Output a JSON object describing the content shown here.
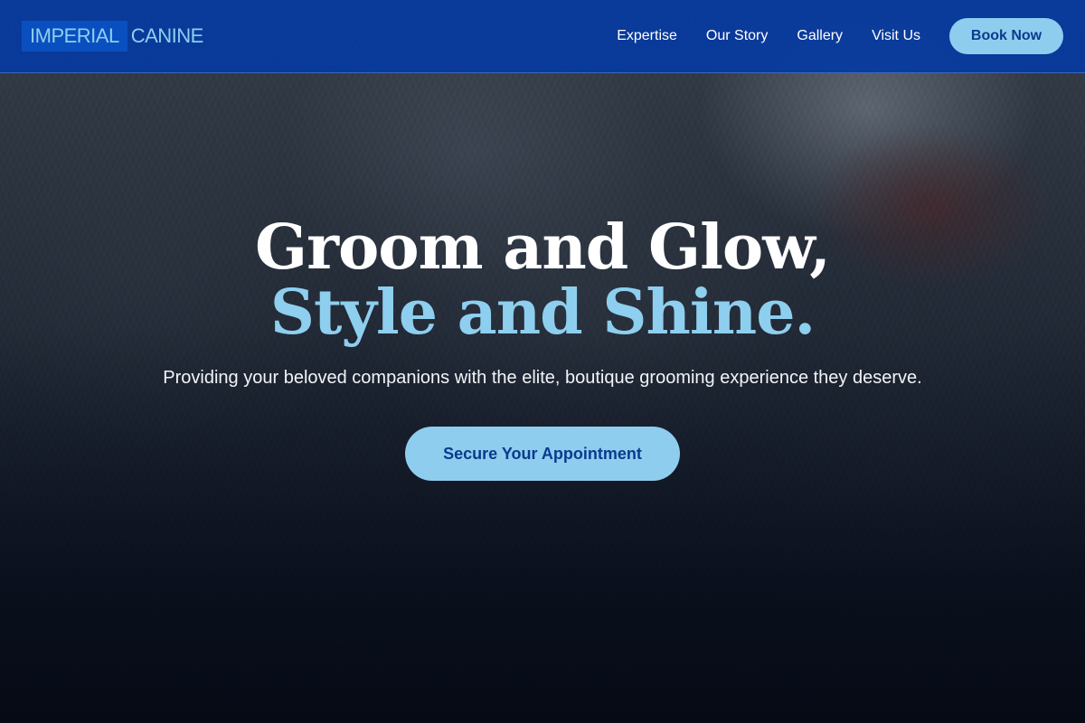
{
  "brand": {
    "part1": "IMPERIAL",
    "part2": "CANINE"
  },
  "nav": {
    "items": [
      {
        "label": "Expertise"
      },
      {
        "label": "Our Story"
      },
      {
        "label": "Gallery"
      },
      {
        "label": "Visit Us"
      }
    ],
    "book_label": "Book Now"
  },
  "hero": {
    "headline_line1": "Groom and Glow,",
    "headline_line2": "Style and Shine.",
    "subtext": "Providing your beloved companions with the elite, boutique grooming experience they deserve.",
    "cta_label": "Secure Your Appointment"
  },
  "colors": {
    "header_bg": "#063aa0",
    "accent_light_blue": "#8ecfef",
    "button_text": "#0a3a8e",
    "hero_overlay": "#0a1322"
  }
}
